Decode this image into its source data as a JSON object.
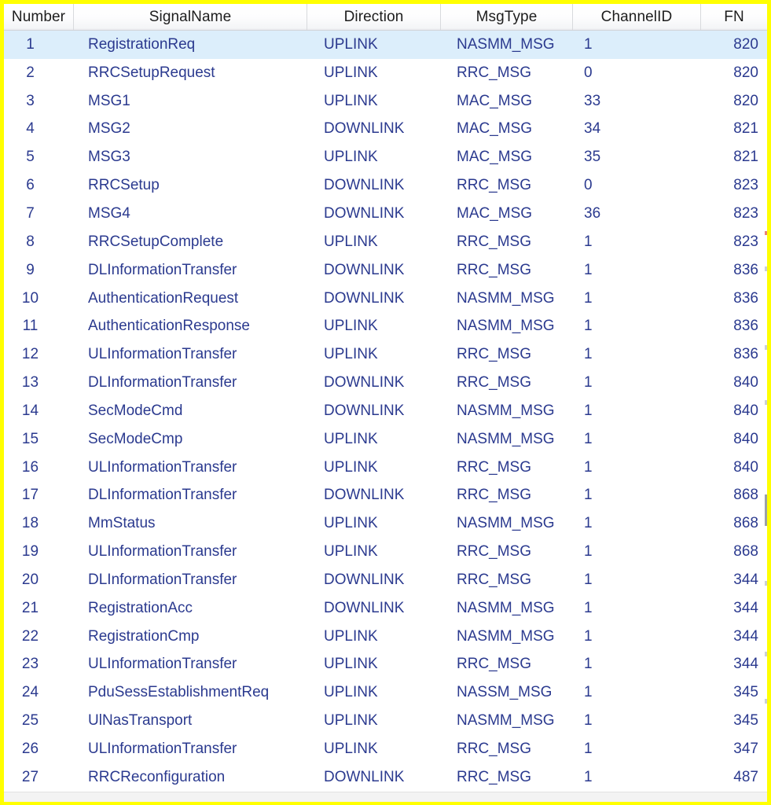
{
  "table": {
    "columns": [
      {
        "key": "number",
        "label": "Number"
      },
      {
        "key": "signalname",
        "label": "SignalName"
      },
      {
        "key": "direction",
        "label": "Direction"
      },
      {
        "key": "msgtype",
        "label": "MsgType"
      },
      {
        "key": "channelid",
        "label": "ChannelID"
      },
      {
        "key": "fn",
        "label": "FN"
      }
    ],
    "selected_row_index": 0,
    "colors": {
      "border_frame": "#ffff00",
      "data_text": "#2b3a8f",
      "header_text": "#1d1d1d",
      "selected_row_bg": "#dceefb",
      "row_bg": "#ffffff",
      "grid_line": "#d8dadd"
    },
    "rows": [
      {
        "number": "1",
        "signalname": "RegistrationReq",
        "direction": "UPLINK",
        "msgtype": "NASMM_MSG",
        "channelid": "1",
        "fn": "820"
      },
      {
        "number": "2",
        "signalname": "RRCSetupRequest",
        "direction": "UPLINK",
        "msgtype": "RRC_MSG",
        "channelid": "0",
        "fn": "820"
      },
      {
        "number": "3",
        "signalname": "MSG1",
        "direction": "UPLINK",
        "msgtype": "MAC_MSG",
        "channelid": "33",
        "fn": "820"
      },
      {
        "number": "4",
        "signalname": "MSG2",
        "direction": "DOWNLINK",
        "msgtype": "MAC_MSG",
        "channelid": "34",
        "fn": "821"
      },
      {
        "number": "5",
        "signalname": "MSG3",
        "direction": "UPLINK",
        "msgtype": "MAC_MSG",
        "channelid": "35",
        "fn": "821"
      },
      {
        "number": "6",
        "signalname": "RRCSetup",
        "direction": "DOWNLINK",
        "msgtype": "RRC_MSG",
        "channelid": "0",
        "fn": "823"
      },
      {
        "number": "7",
        "signalname": "MSG4",
        "direction": "DOWNLINK",
        "msgtype": "MAC_MSG",
        "channelid": "36",
        "fn": "823"
      },
      {
        "number": "8",
        "signalname": "RRCSetupComplete",
        "direction": "UPLINK",
        "msgtype": "RRC_MSG",
        "channelid": "1",
        "fn": "823"
      },
      {
        "number": "9",
        "signalname": "DLInformationTransfer",
        "direction": "DOWNLINK",
        "msgtype": "RRC_MSG",
        "channelid": "1",
        "fn": "836"
      },
      {
        "number": "10",
        "signalname": "AuthenticationRequest",
        "direction": "DOWNLINK",
        "msgtype": "NASMM_MSG",
        "channelid": "1",
        "fn": "836"
      },
      {
        "number": "11",
        "signalname": "AuthenticationResponse",
        "direction": "UPLINK",
        "msgtype": "NASMM_MSG",
        "channelid": "1",
        "fn": "836"
      },
      {
        "number": "12",
        "signalname": "ULInformationTransfer",
        "direction": "UPLINK",
        "msgtype": "RRC_MSG",
        "channelid": "1",
        "fn": "836"
      },
      {
        "number": "13",
        "signalname": "DLInformationTransfer",
        "direction": "DOWNLINK",
        "msgtype": "RRC_MSG",
        "channelid": "1",
        "fn": "840"
      },
      {
        "number": "14",
        "signalname": "SecModeCmd",
        "direction": "DOWNLINK",
        "msgtype": "NASMM_MSG",
        "channelid": "1",
        "fn": "840"
      },
      {
        "number": "15",
        "signalname": "SecModeCmp",
        "direction": "UPLINK",
        "msgtype": "NASMM_MSG",
        "channelid": "1",
        "fn": "840"
      },
      {
        "number": "16",
        "signalname": "ULInformationTransfer",
        "direction": "UPLINK",
        "msgtype": "RRC_MSG",
        "channelid": "1",
        "fn": "840"
      },
      {
        "number": "17",
        "signalname": "DLInformationTransfer",
        "direction": "DOWNLINK",
        "msgtype": "RRC_MSG",
        "channelid": "1",
        "fn": "868"
      },
      {
        "number": "18",
        "signalname": "MmStatus",
        "direction": "UPLINK",
        "msgtype": "NASMM_MSG",
        "channelid": "1",
        "fn": "868"
      },
      {
        "number": "19",
        "signalname": "ULInformationTransfer",
        "direction": "UPLINK",
        "msgtype": "RRC_MSG",
        "channelid": "1",
        "fn": "868"
      },
      {
        "number": "20",
        "signalname": "DLInformationTransfer",
        "direction": "DOWNLINK",
        "msgtype": "RRC_MSG",
        "channelid": "1",
        "fn": "344"
      },
      {
        "number": "21",
        "signalname": "RegistrationAcc",
        "direction": "DOWNLINK",
        "msgtype": "NASMM_MSG",
        "channelid": "1",
        "fn": "344"
      },
      {
        "number": "22",
        "signalname": "RegistrationCmp",
        "direction": "UPLINK",
        "msgtype": "NASMM_MSG",
        "channelid": "1",
        "fn": "344"
      },
      {
        "number": "23",
        "signalname": "ULInformationTransfer",
        "direction": "UPLINK",
        "msgtype": "RRC_MSG",
        "channelid": "1",
        "fn": "344"
      },
      {
        "number": "24",
        "signalname": "PduSessEstablishmentReq",
        "direction": "UPLINK",
        "msgtype": "NASSM_MSG",
        "channelid": "1",
        "fn": "345"
      },
      {
        "number": "25",
        "signalname": "UlNasTransport",
        "direction": "UPLINK",
        "msgtype": "NASMM_MSG",
        "channelid": "1",
        "fn": "345"
      },
      {
        "number": "26",
        "signalname": "ULInformationTransfer",
        "direction": "UPLINK",
        "msgtype": "RRC_MSG",
        "channelid": "1",
        "fn": "347"
      },
      {
        "number": "27",
        "signalname": "RRCReconfiguration",
        "direction": "DOWNLINK",
        "msgtype": "RRC_MSG",
        "channelid": "1",
        "fn": "487"
      }
    ]
  }
}
